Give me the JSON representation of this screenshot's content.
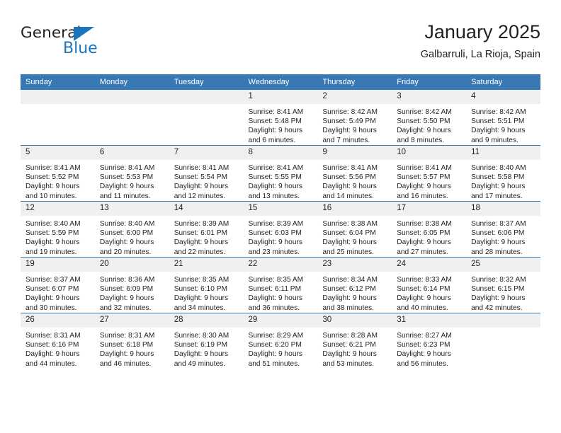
{
  "brand": {
    "name_part1": "General",
    "name_part2": "Blue",
    "triangle_color": "#1b75bb"
  },
  "header": {
    "title": "January 2025",
    "subtitle": "Galbarruli, La Rioja, Spain"
  },
  "theme": {
    "header_row_bg": "#3878b4",
    "day_number_bg": "#f0f0f0",
    "text_color": "#231f20"
  },
  "weekday_headers": [
    "Sunday",
    "Monday",
    "Tuesday",
    "Wednesday",
    "Thursday",
    "Friday",
    "Saturday"
  ],
  "weeks": [
    [
      {
        "day": "",
        "empty": true,
        "sunrise": "",
        "sunset": "",
        "daylight_line1": "",
        "daylight_line2": ""
      },
      {
        "day": "",
        "empty": true,
        "sunrise": "",
        "sunset": "",
        "daylight_line1": "",
        "daylight_line2": ""
      },
      {
        "day": "",
        "empty": true,
        "sunrise": "",
        "sunset": "",
        "daylight_line1": "",
        "daylight_line2": ""
      },
      {
        "day": "1",
        "empty": false,
        "sunrise": "Sunrise: 8:41 AM",
        "sunset": "Sunset: 5:48 PM",
        "daylight_line1": "Daylight: 9 hours",
        "daylight_line2": "and 6 minutes."
      },
      {
        "day": "2",
        "empty": false,
        "sunrise": "Sunrise: 8:42 AM",
        "sunset": "Sunset: 5:49 PM",
        "daylight_line1": "Daylight: 9 hours",
        "daylight_line2": "and 7 minutes."
      },
      {
        "day": "3",
        "empty": false,
        "sunrise": "Sunrise: 8:42 AM",
        "sunset": "Sunset: 5:50 PM",
        "daylight_line1": "Daylight: 9 hours",
        "daylight_line2": "and 8 minutes."
      },
      {
        "day": "4",
        "empty": false,
        "sunrise": "Sunrise: 8:42 AM",
        "sunset": "Sunset: 5:51 PM",
        "daylight_line1": "Daylight: 9 hours",
        "daylight_line2": "and 9 minutes."
      }
    ],
    [
      {
        "day": "5",
        "empty": false,
        "sunrise": "Sunrise: 8:41 AM",
        "sunset": "Sunset: 5:52 PM",
        "daylight_line1": "Daylight: 9 hours",
        "daylight_line2": "and 10 minutes."
      },
      {
        "day": "6",
        "empty": false,
        "sunrise": "Sunrise: 8:41 AM",
        "sunset": "Sunset: 5:53 PM",
        "daylight_line1": "Daylight: 9 hours",
        "daylight_line2": "and 11 minutes."
      },
      {
        "day": "7",
        "empty": false,
        "sunrise": "Sunrise: 8:41 AM",
        "sunset": "Sunset: 5:54 PM",
        "daylight_line1": "Daylight: 9 hours",
        "daylight_line2": "and 12 minutes."
      },
      {
        "day": "8",
        "empty": false,
        "sunrise": "Sunrise: 8:41 AM",
        "sunset": "Sunset: 5:55 PM",
        "daylight_line1": "Daylight: 9 hours",
        "daylight_line2": "and 13 minutes."
      },
      {
        "day": "9",
        "empty": false,
        "sunrise": "Sunrise: 8:41 AM",
        "sunset": "Sunset: 5:56 PM",
        "daylight_line1": "Daylight: 9 hours",
        "daylight_line2": "and 14 minutes."
      },
      {
        "day": "10",
        "empty": false,
        "sunrise": "Sunrise: 8:41 AM",
        "sunset": "Sunset: 5:57 PM",
        "daylight_line1": "Daylight: 9 hours",
        "daylight_line2": "and 16 minutes."
      },
      {
        "day": "11",
        "empty": false,
        "sunrise": "Sunrise: 8:40 AM",
        "sunset": "Sunset: 5:58 PM",
        "daylight_line1": "Daylight: 9 hours",
        "daylight_line2": "and 17 minutes."
      }
    ],
    [
      {
        "day": "12",
        "empty": false,
        "sunrise": "Sunrise: 8:40 AM",
        "sunset": "Sunset: 5:59 PM",
        "daylight_line1": "Daylight: 9 hours",
        "daylight_line2": "and 19 minutes."
      },
      {
        "day": "13",
        "empty": false,
        "sunrise": "Sunrise: 8:40 AM",
        "sunset": "Sunset: 6:00 PM",
        "daylight_line1": "Daylight: 9 hours",
        "daylight_line2": "and 20 minutes."
      },
      {
        "day": "14",
        "empty": false,
        "sunrise": "Sunrise: 8:39 AM",
        "sunset": "Sunset: 6:01 PM",
        "daylight_line1": "Daylight: 9 hours",
        "daylight_line2": "and 22 minutes."
      },
      {
        "day": "15",
        "empty": false,
        "sunrise": "Sunrise: 8:39 AM",
        "sunset": "Sunset: 6:03 PM",
        "daylight_line1": "Daylight: 9 hours",
        "daylight_line2": "and 23 minutes."
      },
      {
        "day": "16",
        "empty": false,
        "sunrise": "Sunrise: 8:38 AM",
        "sunset": "Sunset: 6:04 PM",
        "daylight_line1": "Daylight: 9 hours",
        "daylight_line2": "and 25 minutes."
      },
      {
        "day": "17",
        "empty": false,
        "sunrise": "Sunrise: 8:38 AM",
        "sunset": "Sunset: 6:05 PM",
        "daylight_line1": "Daylight: 9 hours",
        "daylight_line2": "and 27 minutes."
      },
      {
        "day": "18",
        "empty": false,
        "sunrise": "Sunrise: 8:37 AM",
        "sunset": "Sunset: 6:06 PM",
        "daylight_line1": "Daylight: 9 hours",
        "daylight_line2": "and 28 minutes."
      }
    ],
    [
      {
        "day": "19",
        "empty": false,
        "sunrise": "Sunrise: 8:37 AM",
        "sunset": "Sunset: 6:07 PM",
        "daylight_line1": "Daylight: 9 hours",
        "daylight_line2": "and 30 minutes."
      },
      {
        "day": "20",
        "empty": false,
        "sunrise": "Sunrise: 8:36 AM",
        "sunset": "Sunset: 6:09 PM",
        "daylight_line1": "Daylight: 9 hours",
        "daylight_line2": "and 32 minutes."
      },
      {
        "day": "21",
        "empty": false,
        "sunrise": "Sunrise: 8:35 AM",
        "sunset": "Sunset: 6:10 PM",
        "daylight_line1": "Daylight: 9 hours",
        "daylight_line2": "and 34 minutes."
      },
      {
        "day": "22",
        "empty": false,
        "sunrise": "Sunrise: 8:35 AM",
        "sunset": "Sunset: 6:11 PM",
        "daylight_line1": "Daylight: 9 hours",
        "daylight_line2": "and 36 minutes."
      },
      {
        "day": "23",
        "empty": false,
        "sunrise": "Sunrise: 8:34 AM",
        "sunset": "Sunset: 6:12 PM",
        "daylight_line1": "Daylight: 9 hours",
        "daylight_line2": "and 38 minutes."
      },
      {
        "day": "24",
        "empty": false,
        "sunrise": "Sunrise: 8:33 AM",
        "sunset": "Sunset: 6:14 PM",
        "daylight_line1": "Daylight: 9 hours",
        "daylight_line2": "and 40 minutes."
      },
      {
        "day": "25",
        "empty": false,
        "sunrise": "Sunrise: 8:32 AM",
        "sunset": "Sunset: 6:15 PM",
        "daylight_line1": "Daylight: 9 hours",
        "daylight_line2": "and 42 minutes."
      }
    ],
    [
      {
        "day": "26",
        "empty": false,
        "sunrise": "Sunrise: 8:31 AM",
        "sunset": "Sunset: 6:16 PM",
        "daylight_line1": "Daylight: 9 hours",
        "daylight_line2": "and 44 minutes."
      },
      {
        "day": "27",
        "empty": false,
        "sunrise": "Sunrise: 8:31 AM",
        "sunset": "Sunset: 6:18 PM",
        "daylight_line1": "Daylight: 9 hours",
        "daylight_line2": "and 46 minutes."
      },
      {
        "day": "28",
        "empty": false,
        "sunrise": "Sunrise: 8:30 AM",
        "sunset": "Sunset: 6:19 PM",
        "daylight_line1": "Daylight: 9 hours",
        "daylight_line2": "and 49 minutes."
      },
      {
        "day": "29",
        "empty": false,
        "sunrise": "Sunrise: 8:29 AM",
        "sunset": "Sunset: 6:20 PM",
        "daylight_line1": "Daylight: 9 hours",
        "daylight_line2": "and 51 minutes."
      },
      {
        "day": "30",
        "empty": false,
        "sunrise": "Sunrise: 8:28 AM",
        "sunset": "Sunset: 6:21 PM",
        "daylight_line1": "Daylight: 9 hours",
        "daylight_line2": "and 53 minutes."
      },
      {
        "day": "31",
        "empty": false,
        "sunrise": "Sunrise: 8:27 AM",
        "sunset": "Sunset: 6:23 PM",
        "daylight_line1": "Daylight: 9 hours",
        "daylight_line2": "and 56 minutes."
      },
      {
        "day": "",
        "empty": true,
        "sunrise": "",
        "sunset": "",
        "daylight_line1": "",
        "daylight_line2": ""
      }
    ]
  ]
}
